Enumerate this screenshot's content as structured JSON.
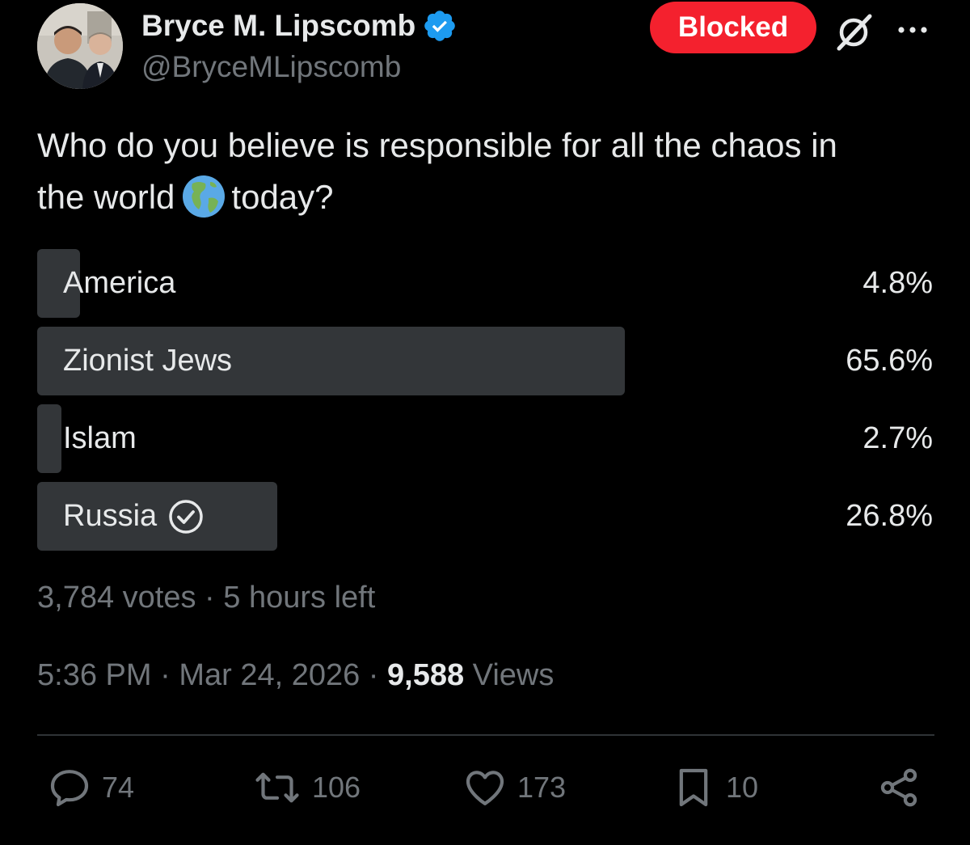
{
  "colors": {
    "background": "#000000",
    "text_primary": "#e7e9ea",
    "text_secondary": "#71767b",
    "blocked_red": "#f4212e",
    "verified_blue": "#1d9bf0",
    "poll_bar": "#333639",
    "divider": "#2f3336"
  },
  "author": {
    "display_name": "Bryce M. Lipscomb",
    "handle": "@BryceMLipscomb",
    "verified_icon": "verified-badge-icon",
    "avatar_icon": "profile-photo"
  },
  "header": {
    "blocked_label": "Blocked",
    "grok_icon": "grok-icon",
    "more_icon": "more-icon"
  },
  "tweet": {
    "text_line1": "Who do you believe is responsible for all the chaos in",
    "text_before_emoji": "the world",
    "emoji": "globe-americas-icon",
    "text_after_emoji": "today?"
  },
  "poll": {
    "options": [
      {
        "label": "America",
        "percent": "4.8%",
        "fraction": 0.048,
        "voted": false
      },
      {
        "label": "Zionist Jews",
        "percent": "65.6%",
        "fraction": 0.656,
        "voted": false
      },
      {
        "label": "Islam",
        "percent": "2.7%",
        "fraction": 0.027,
        "voted": false
      },
      {
        "label": "Russia",
        "percent": "26.8%",
        "fraction": 0.268,
        "voted": true
      }
    ],
    "votes": "3,784 votes",
    "separator": "·",
    "time_left": "5 hours left"
  },
  "meta": {
    "time": "5:36 PM",
    "separator": "·",
    "date": "Mar 24, 2026",
    "views_count": "9,588",
    "views_label": "Views"
  },
  "actions": {
    "replies": "74",
    "reposts": "106",
    "likes": "173",
    "bookmarks": "10",
    "reply_icon": "reply-icon",
    "repost_icon": "repost-icon",
    "like_icon": "heart-icon",
    "bookmark_icon": "bookmark-icon",
    "share_icon": "share-icon"
  }
}
